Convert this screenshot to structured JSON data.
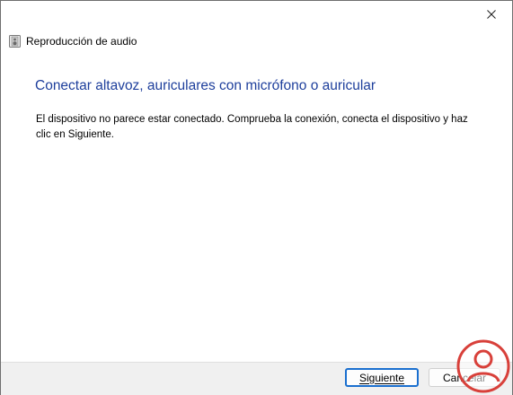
{
  "window": {
    "close_icon": "close-icon"
  },
  "header": {
    "icon": "speaker-device-icon",
    "title": "Reproducción de audio"
  },
  "main": {
    "heading": "Conectar altavoz, auriculares con micrófono o auricular",
    "body": "El dispositivo no parece estar conectado. Comprueba la conexión, conecta el dispositivo y haz clic en Siguiente."
  },
  "footer": {
    "next_label": "Siguiente",
    "cancel_label": "Cancelar"
  },
  "colors": {
    "heading": "#1e3f9c",
    "default_button_border": "#1a6fcf",
    "watermark": "#d8403a"
  },
  "watermark": {
    "icon": "user-silhouette-logo"
  }
}
